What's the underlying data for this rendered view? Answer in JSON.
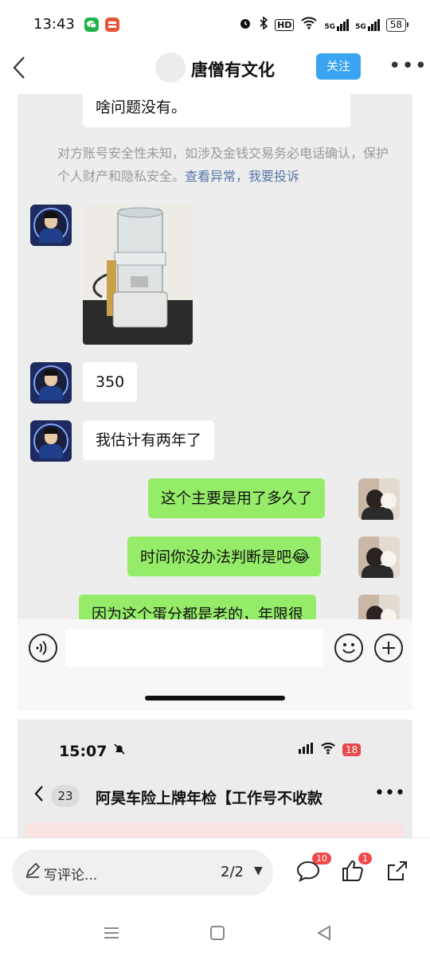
{
  "status_bar": {
    "time": "13:43",
    "app_icons": [
      "wechat-icon",
      "shop-icon"
    ],
    "net_5g_a": "5G",
    "net_5g_b": "5G",
    "hd_label": "HD",
    "battery": "58"
  },
  "header": {
    "title": "唐僧有文化",
    "follow_label": "关注",
    "more_label": "•••"
  },
  "chat": {
    "partial_message": "啥问题没有。",
    "notice_text": "对方账号安全性未知，如涉及金钱交易务必电话确认，保护个人财产和隐私安全。",
    "notice_link1": "查看异常",
    "notice_sep": "，",
    "notice_link2": "我要投诉",
    "messages": [
      {
        "side": "left",
        "text": "350"
      },
      {
        "side": "left",
        "text": "我估计有两年了"
      },
      {
        "side": "right",
        "text": "这个主要是用了多久了"
      },
      {
        "side": "right",
        "text": "时间你没办法判断是吧"
      },
      {
        "side": "right",
        "text": "因为这个蛋分都是老的，年限很"
      }
    ],
    "emoji": "😂"
  },
  "embedded_screen": {
    "time": "15:07",
    "battery": "18",
    "back_count": "23",
    "title": "阿昊车险上牌年检【工作号不收款",
    "more_label": "•••"
  },
  "bottom_bar": {
    "write_placeholder": "写评论...",
    "page_indicator": "2/2",
    "comment_count": "10",
    "like_count": "1"
  },
  "colors": {
    "accent": "#3aa3f2",
    "sent_bubble": "#95ec69",
    "badge": "#f0484a"
  }
}
